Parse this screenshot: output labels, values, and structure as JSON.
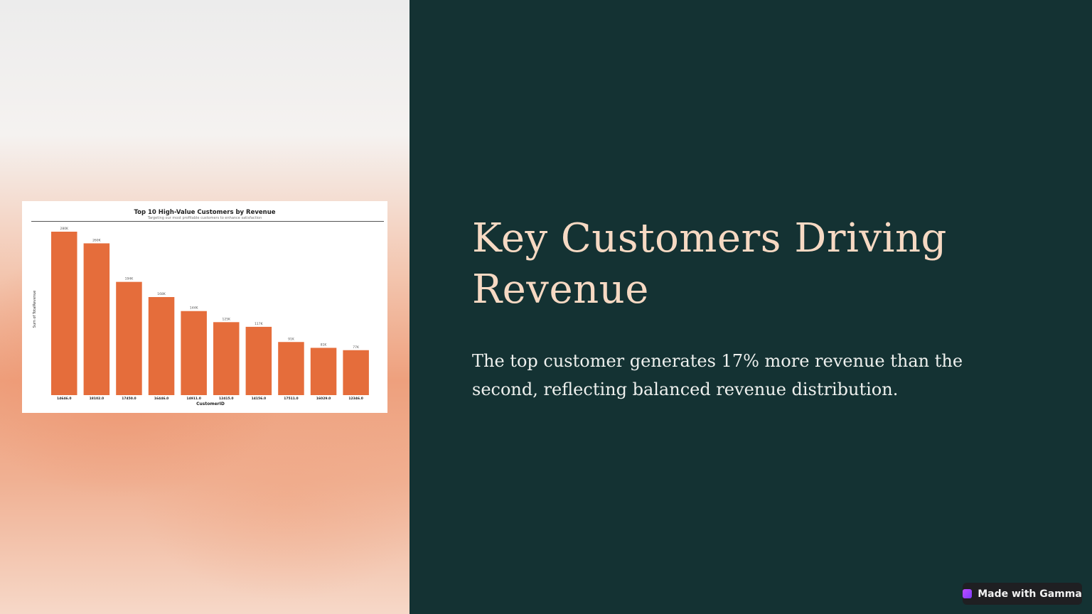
{
  "slide": {
    "title": "Key Customers Driving Revenue",
    "body": "The top customer generates 17% more revenue than the second, reflecting balanced revenue distribution."
  },
  "badge": {
    "label": "Made with Gamma",
    "icon": "gamma-logo-icon"
  },
  "colors": {
    "bar": "#e56d3b",
    "title_text": "#f6d9c3",
    "panel_bg": "#143233"
  },
  "chart_data": {
    "type": "bar",
    "title": "Top 10 High-Value Customers by Revenue",
    "subtitle": "Targeting our most profitable customers to enhance satisfaction",
    "xlabel": "CustomerID",
    "ylabel": "Sum of TotalRevenue",
    "categories": [
      "14646.0",
      "18102.0",
      "17450.0",
      "16446.0",
      "14911.0",
      "12415.0",
      "14156.0",
      "17511.0",
      "16029.0",
      "12346.0"
    ],
    "values": [
      280000,
      260000,
      194000,
      168000,
      144000,
      125000,
      117000,
      91000,
      81000,
      77000
    ],
    "value_labels": [
      "280K",
      "260K",
      "194K",
      "168K",
      "144K",
      "125K",
      "117K",
      "91K",
      "81K",
      "77K"
    ],
    "ylim": [
      0,
      280000
    ],
    "grid": false,
    "legend": "none"
  }
}
